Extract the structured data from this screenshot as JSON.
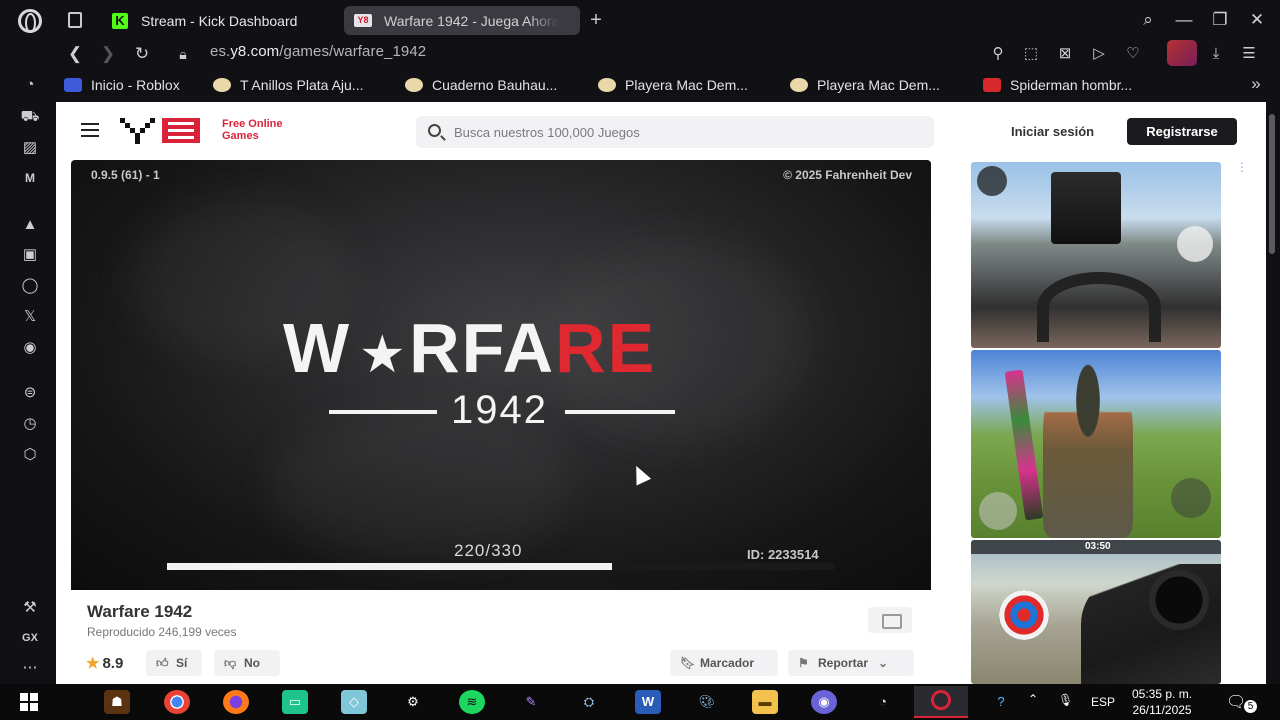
{
  "browser": {
    "tabs": [
      {
        "label": "Stream - Kick Dashboard"
      },
      {
        "label": "Warfare 1942 - Juega Ahora"
      }
    ],
    "url_prefix": "es.",
    "url_domain": "y8.com",
    "url_path": "/games/warfare_1942"
  },
  "bookmarks": [
    {
      "label": "Inicio - Roblox",
      "icon_color": "#3d5bd8"
    },
    {
      "label": "T Anillos Plata Aju...",
      "icon_color": "#e9d9a8"
    },
    {
      "label": "Cuaderno Bauhau...",
      "icon_color": "#e9d9a8"
    },
    {
      "label": "Playera Mac Dem...",
      "icon_color": "#e9d9a8"
    },
    {
      "label": "Playera Mac Dem...",
      "icon_color": "#e9d9a8"
    },
    {
      "label": "Spiderman hombr...",
      "icon_color": "#d8282a"
    }
  ],
  "site": {
    "logo_line1": "Free Online",
    "logo_line2": "Games",
    "search_placeholder": "Busca nuestros 100,000 Juegos",
    "login_label": "Iniciar sesión",
    "register_label": "Registrarse",
    "brand_color": "#d9233a"
  },
  "game": {
    "version": "0.9.5 (61) - 1",
    "copyright": "© 2025 Fahrenheit Dev",
    "title_part1": "W",
    "title_part2": "R",
    "title_part3": "FA",
    "title_part4": "RE",
    "year": "1942",
    "progress_text": "220/330",
    "progress_fraction": 0.667,
    "id_text": "ID: 2233514",
    "name": "Warfare 1942",
    "plays": "Reproducido 246,199 veces",
    "rating": "8.9",
    "like_label": "Sí",
    "dislike_label": "No",
    "bookmark_label": "Marcador",
    "report_label": "Reportar"
  },
  "thumbnails": [
    {
      "name": "bus-driving-game",
      "hud_time": ""
    },
    {
      "name": "soldier-shooter-game",
      "hud_time": ""
    },
    {
      "name": "sniper-archery-game",
      "hud_time": "03:50"
    }
  ],
  "taskbar": {
    "lang": "ESP",
    "time": "05:35 p. m.",
    "date": "26/11/2025",
    "notifications": "5"
  }
}
